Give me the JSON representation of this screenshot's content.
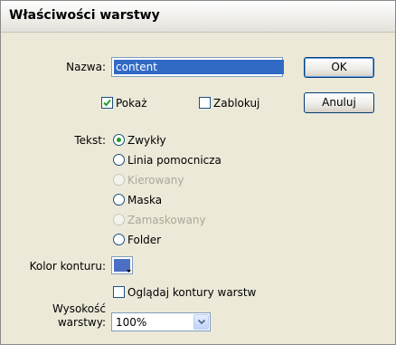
{
  "window": {
    "title": "Właściwości warstwy"
  },
  "name": {
    "label": "Nazwa:",
    "value": "content"
  },
  "buttons": {
    "ok": "OK",
    "cancel": "Anuluj"
  },
  "checkboxes": {
    "show": {
      "label": "Pokaż",
      "checked": true
    },
    "lock": {
      "label": "Zablokuj",
      "checked": false
    }
  },
  "type": {
    "label": "Tekst:",
    "options": [
      {
        "label": "Zwykły",
        "selected": true,
        "enabled": true
      },
      {
        "label": "Linia pomocnicza",
        "selected": false,
        "enabled": true
      },
      {
        "label": "Kierowany",
        "selected": false,
        "enabled": false
      },
      {
        "label": "Maska",
        "selected": false,
        "enabled": true
      },
      {
        "label": "Zamaskowany",
        "selected": false,
        "enabled": false
      },
      {
        "label": "Folder",
        "selected": false,
        "enabled": true
      }
    ]
  },
  "outline": {
    "label": "Kolor konturu:",
    "color": "#4b6fc2",
    "view_as_outlines": {
      "label": "Oglądaj kontury warstw",
      "checked": false
    }
  },
  "height": {
    "label_line1": "Wysokość",
    "label_line2": "warstwy:",
    "value": "100%"
  }
}
